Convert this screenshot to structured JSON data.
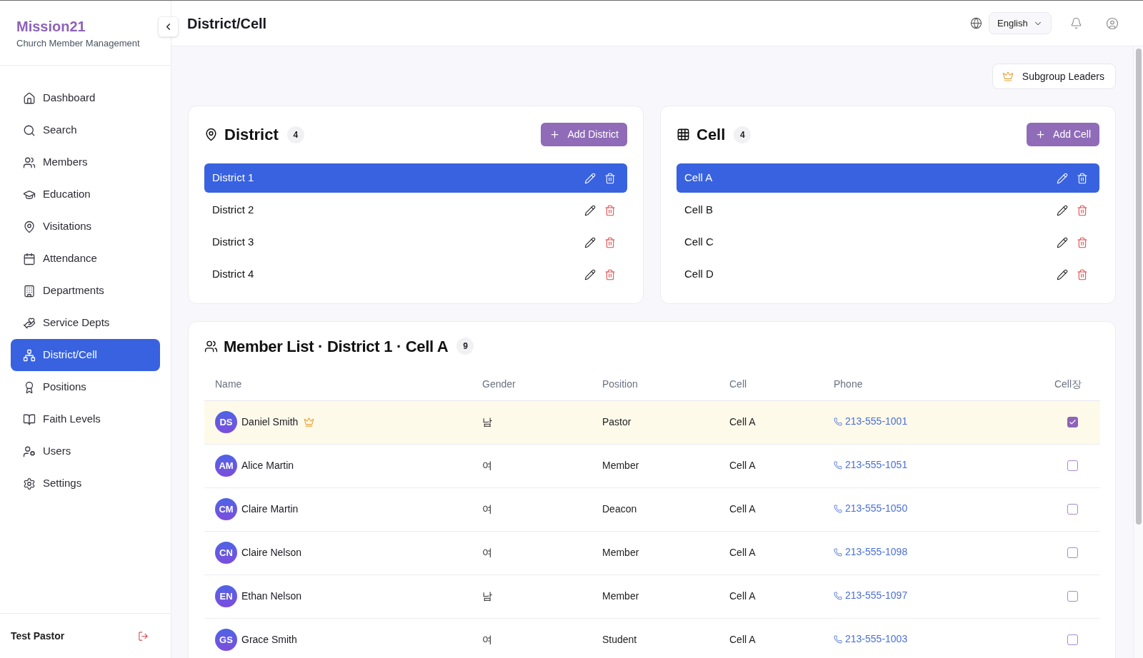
{
  "sidebar": {
    "brand": "Mission21",
    "subtitle": "Church Member Management",
    "items": [
      {
        "label": "Dashboard",
        "selected": false
      },
      {
        "label": "Search",
        "selected": false
      },
      {
        "label": "Members",
        "selected": false
      },
      {
        "label": "Education",
        "selected": false
      },
      {
        "label": "Visitations",
        "selected": false
      },
      {
        "label": "Attendance",
        "selected": false
      },
      {
        "label": "Departments",
        "selected": false
      },
      {
        "label": "Service Depts",
        "selected": false
      },
      {
        "label": "District/Cell",
        "selected": true
      },
      {
        "label": "Positions",
        "selected": false
      },
      {
        "label": "Faith Levels",
        "selected": false
      },
      {
        "label": "Users",
        "selected": false
      },
      {
        "label": "Settings",
        "selected": false
      }
    ],
    "user": "Test Pastor"
  },
  "header": {
    "title": "District/Cell",
    "language": "English"
  },
  "toolbar": {
    "subgroup_leaders": "Subgroup Leaders"
  },
  "district_panel": {
    "title": "District",
    "count": "4",
    "add_button": "Add District",
    "items": [
      {
        "label": "District 1",
        "selected": true
      },
      {
        "label": "District 2",
        "selected": false
      },
      {
        "label": "District 3",
        "selected": false
      },
      {
        "label": "District 4",
        "selected": false
      }
    ]
  },
  "cell_panel": {
    "title": "Cell",
    "count": "4",
    "add_button": "Add Cell",
    "items": [
      {
        "label": "Cell A",
        "selected": true
      },
      {
        "label": "Cell B",
        "selected": false
      },
      {
        "label": "Cell C",
        "selected": false
      },
      {
        "label": "Cell D",
        "selected": false
      }
    ]
  },
  "member_list": {
    "title": "Member List · District 1 · Cell A",
    "count": "9",
    "columns": [
      "Name",
      "Gender",
      "Position",
      "Cell",
      "Phone",
      "Cell장"
    ],
    "rows": [
      {
        "initials": "DS",
        "name": "Daniel Smith",
        "gender": "남",
        "position": "Pastor",
        "cell": "Cell A",
        "phone": "213-555-1001",
        "cell_leader": true
      },
      {
        "initials": "AM",
        "name": "Alice Martin",
        "gender": "여",
        "position": "Member",
        "cell": "Cell A",
        "phone": "213-555-1051",
        "cell_leader": false
      },
      {
        "initials": "CM",
        "name": "Claire Martin",
        "gender": "여",
        "position": "Deacon",
        "cell": "Cell A",
        "phone": "213-555-1050",
        "cell_leader": false
      },
      {
        "initials": "CN",
        "name": "Claire Nelson",
        "gender": "여",
        "position": "Member",
        "cell": "Cell A",
        "phone": "213-555-1098",
        "cell_leader": false
      },
      {
        "initials": "EN",
        "name": "Ethan Nelson",
        "gender": "남",
        "position": "Member",
        "cell": "Cell A",
        "phone": "213-555-1097",
        "cell_leader": false
      },
      {
        "initials": "GS",
        "name": "Grace Smith",
        "gender": "여",
        "position": "Student",
        "cell": "Cell A",
        "phone": "213-555-1003",
        "cell_leader": false
      }
    ]
  }
}
